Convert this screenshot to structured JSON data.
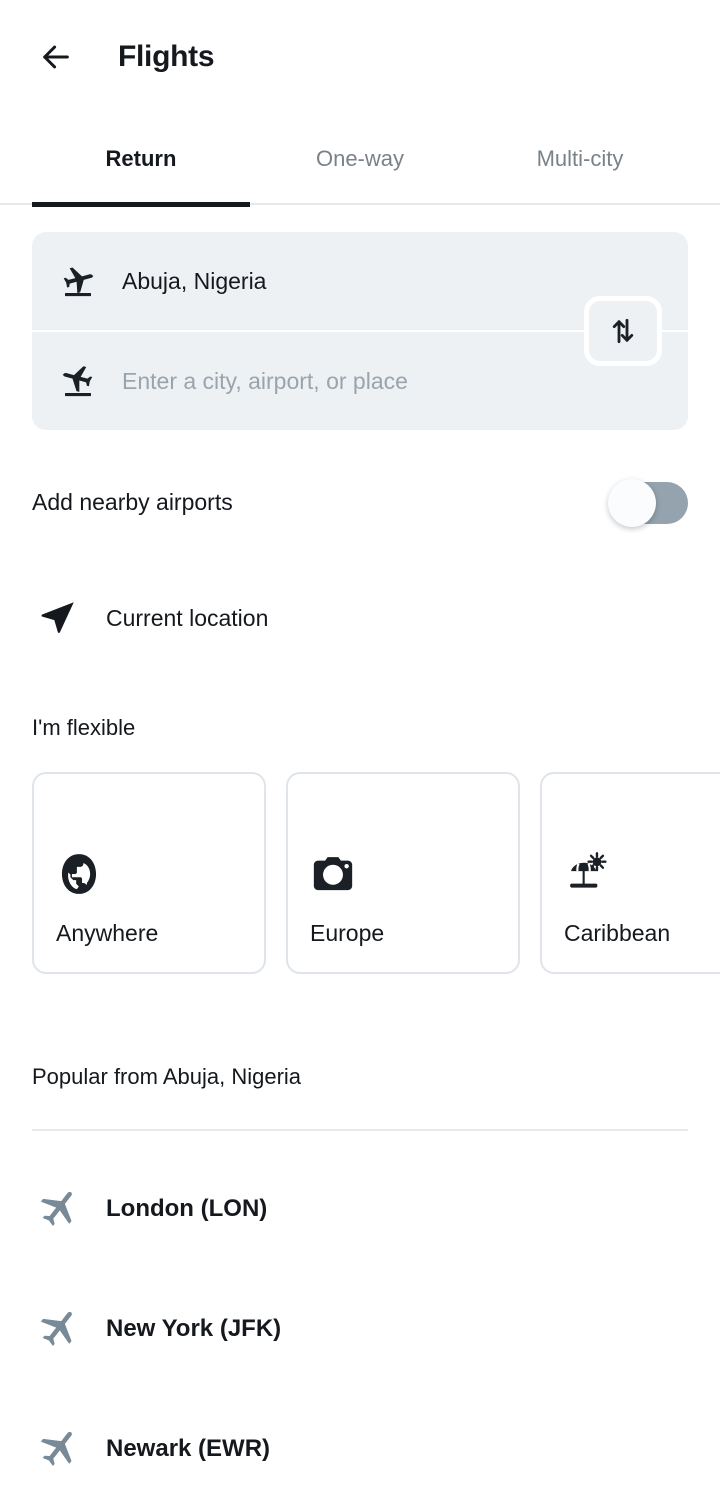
{
  "header": {
    "back_icon": "arrow-left-icon",
    "title": "Flights"
  },
  "tabs": [
    {
      "label": "Return",
      "active": true
    },
    {
      "label": "One-way",
      "active": false
    },
    {
      "label": "Multi-city",
      "active": false
    }
  ],
  "search": {
    "origin": {
      "icon": "flight-takeoff-icon",
      "value": "Abuja, Nigeria"
    },
    "destination": {
      "icon": "flight-land-icon",
      "placeholder": "Enter a city, airport, or place",
      "value": ""
    },
    "swap_icon": "swap-vertical-icon"
  },
  "nearby": {
    "label": "Add nearby airports",
    "toggle_state": "off"
  },
  "current_location": {
    "icon": "navigation-arrow-icon",
    "label": "Current location"
  },
  "flexible": {
    "title": "I'm flexible",
    "cards": [
      {
        "label": "Anywhere",
        "icon": "globe-icon"
      },
      {
        "label": "Europe",
        "icon": "camera-icon"
      },
      {
        "label": "Caribbean",
        "icon": "beach-umbrella-icon"
      }
    ]
  },
  "popular": {
    "title": "Popular from Abuja, Nigeria",
    "items": [
      {
        "label": "London (LON)",
        "icon": "airplane-icon"
      },
      {
        "label": "New York (JFK)",
        "icon": "airplane-icon"
      },
      {
        "label": "Newark (EWR)",
        "icon": "airplane-icon"
      }
    ]
  },
  "colors": {
    "text_primary": "#15191e",
    "text_muted": "#7a8289",
    "field_bg": "#eef1f4",
    "border": "#dfe5ea",
    "toggle_track": "#94a3ae",
    "plane_icon": "#788a97"
  }
}
